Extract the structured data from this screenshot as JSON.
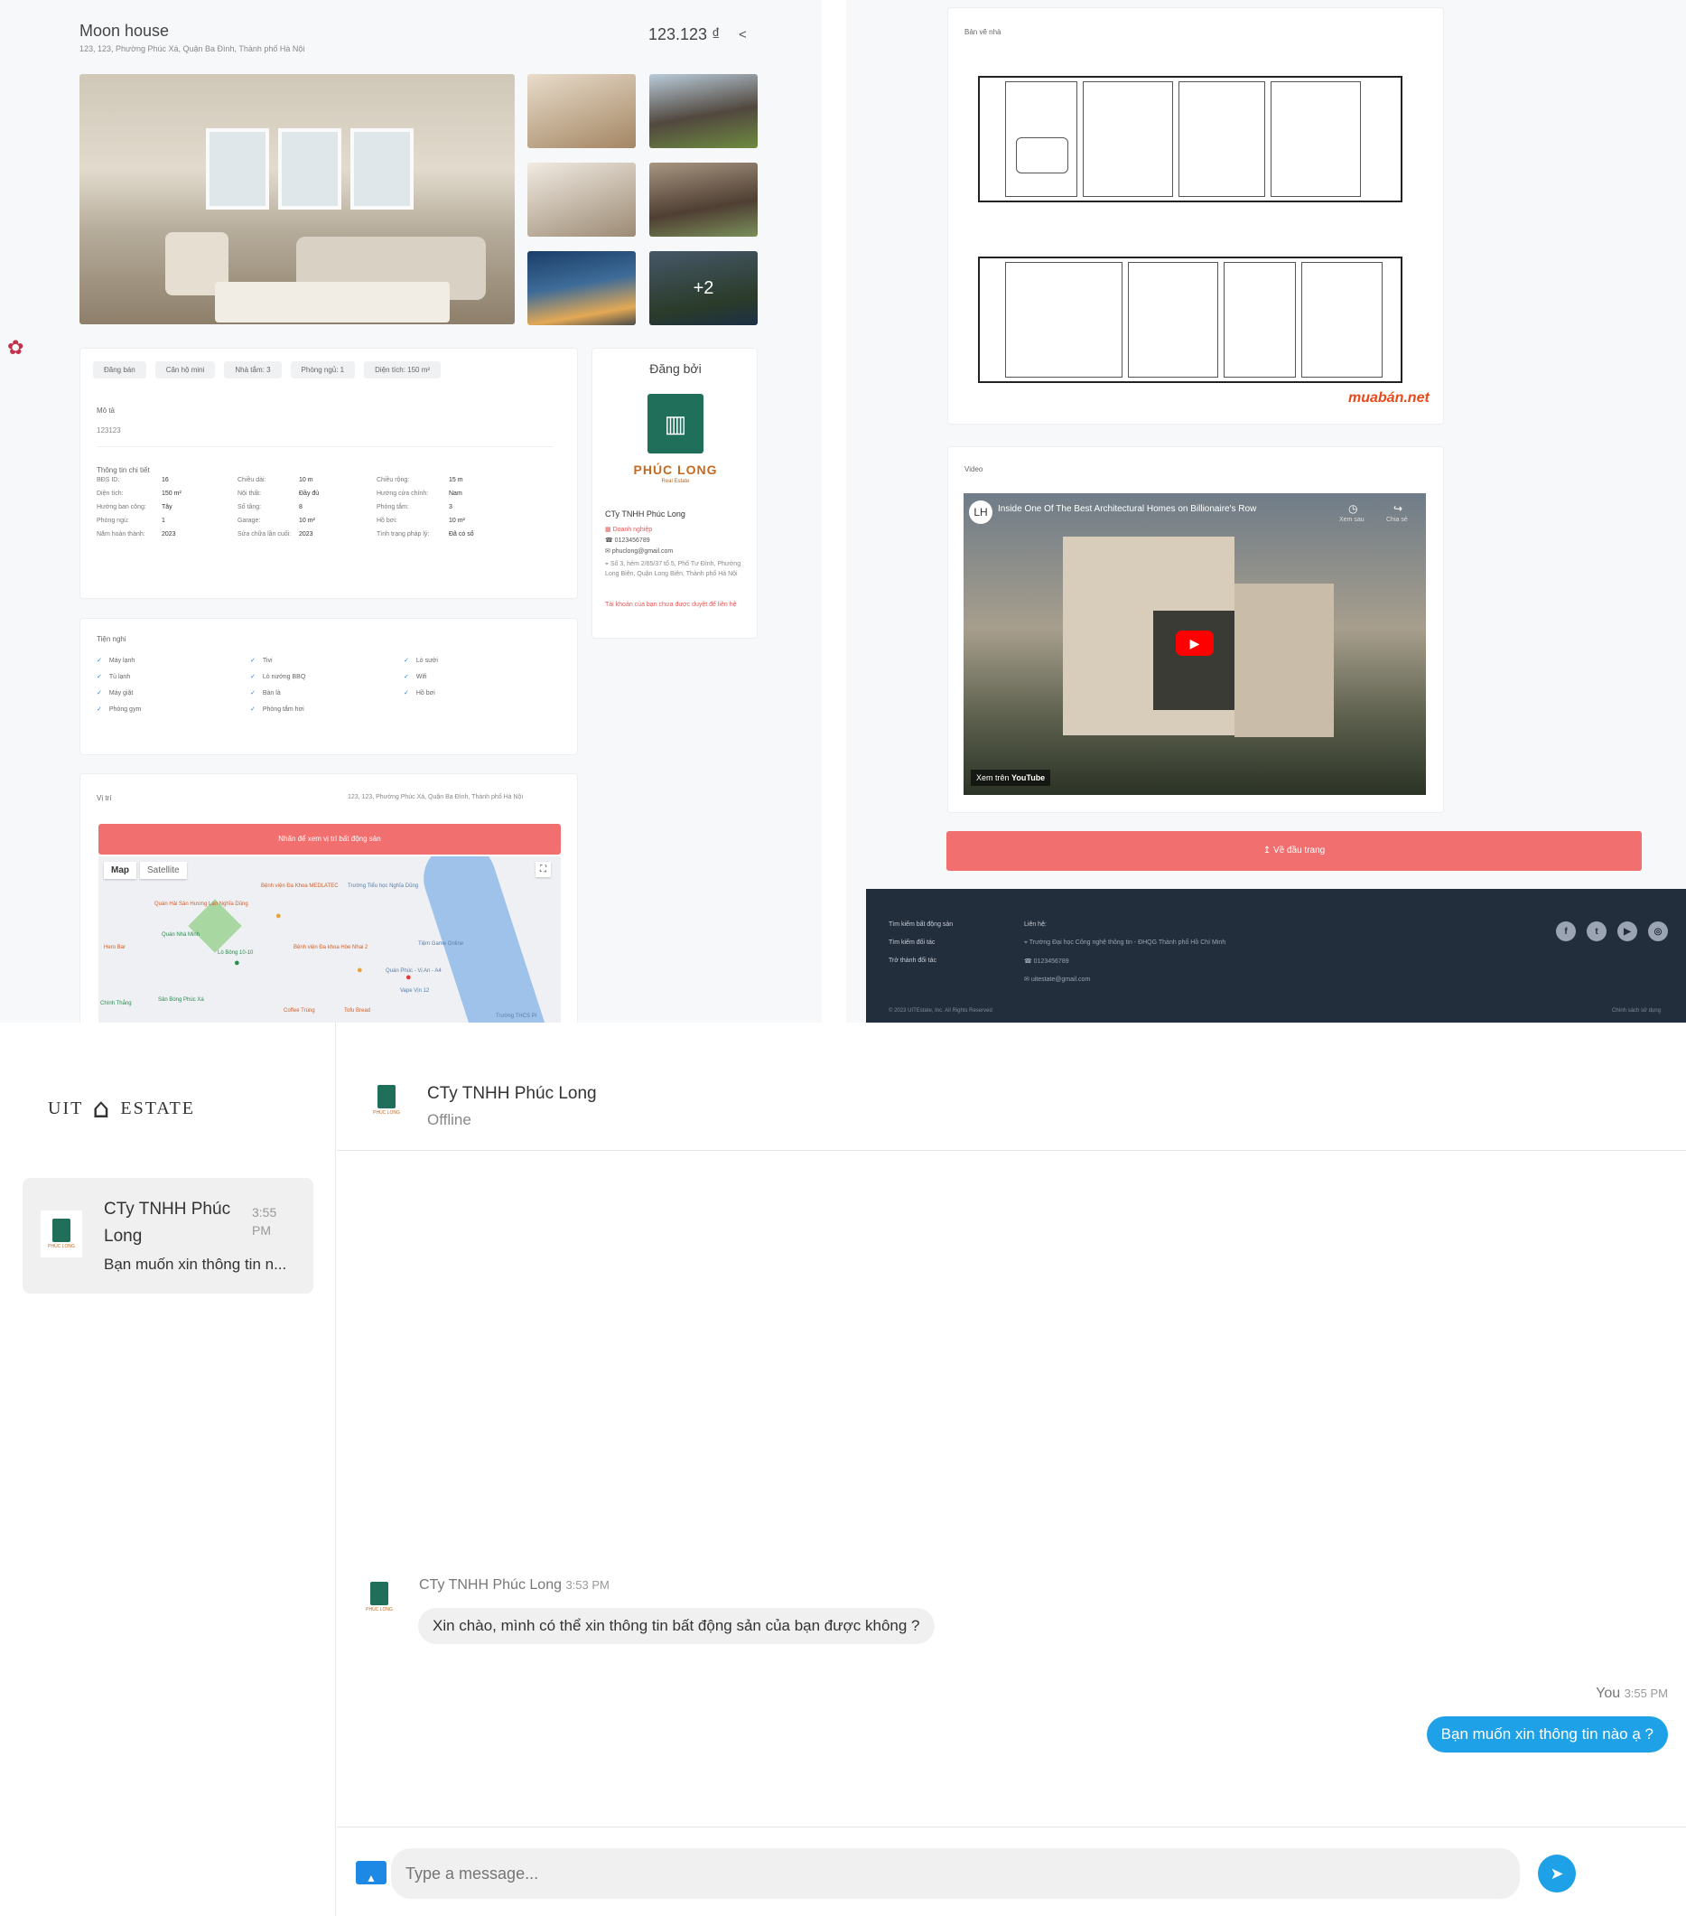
{
  "listing": {
    "title": "Moon house",
    "address": "123, 123, Phường Phúc Xá, Quận Ba Đình, Thành phố Hà Nội",
    "price": "123.123 ₫",
    "more_photos": "+2",
    "chips": [
      "Đăng bán",
      "Căn hộ mini",
      "Nhà tắm: 3",
      "Phòng ngủ: 1",
      "Diện tích: 150 m²"
    ],
    "description_label": "Mô tả",
    "description": "123123",
    "details_label": "Thông tin chi tiết",
    "details": [
      [
        "BĐS ID:",
        "16",
        "Chiều dài:",
        "10 m",
        "Chiều rộng:",
        "15 m"
      ],
      [
        "Diện tích:",
        "150 m²",
        "Nội thất:",
        "Đầy đủ",
        "Hướng cửa chính:",
        "Nam"
      ],
      [
        "Hướng ban công:",
        "Tây",
        "Số tầng:",
        "8",
        "Phòng tắm:",
        "3"
      ],
      [
        "Phòng ngủ:",
        "1",
        "Garage:",
        "10 m²",
        "Hồ bơi:",
        "10 m²"
      ],
      [
        "Năm hoàn thành:",
        "2023",
        "Sửa chữa lần cuối:",
        "2023",
        "Tình trạng pháp lý:",
        "Đã có sổ"
      ]
    ],
    "amenities_label": "Tiện nghi",
    "amenities": [
      "Máy lạnh",
      "Tivi",
      "Lò sưởi",
      "Tủ lạnh",
      "Lò nướng BBQ",
      "Wifi",
      "Máy giặt",
      "Bàn là",
      "Hồ bơi",
      "Phòng gym",
      "Phòng tắm hơi"
    ],
    "location_label": "Vị trí",
    "location_address": "123, 123, Phường Phúc Xá, Quận Ba Đình, Thành phố Hà Nội",
    "map_button": "Nhấn để xem vị trí bất động sản",
    "map_tabs": [
      "Map",
      "Satellite"
    ],
    "map_labels": [
      "Bệnh viện Đa Khoa MEDLATEC",
      "Trường Tiểu học Nghĩa Dũng",
      "Quán Hải Sản Hương Lan Nghĩa Dũng",
      "Quán Nhà Minh",
      "Hero Bar",
      "Lò Bông 10-10",
      "Bệnh viện Đa khoa Hòe Nhai 2",
      "Tiệm Game Online",
      "Quán Phúc - Vị An - A4",
      "Vape Vịn 12",
      "Coffee Trùng",
      "Tofu Bread",
      "Chính Thắng",
      "Sân Bóng Phúc Xá",
      "Trường THCS PI"
    ]
  },
  "agent": {
    "posted_by": "Đăng bởi",
    "logo_text": "PHÚC LONG",
    "logo_sub": "Real Estate",
    "name": "CTy TNHH Phúc Long",
    "type": "Doanh nghiệp",
    "phone": "0123456789",
    "email": "phuclong@gmail.com",
    "address": "Số 3, hẻm 2/65/37 tổ 5, Phố Tư Đình, Phường Long Biên, Quận Long Biên, Thành phố Hà Nội",
    "warning": "Tài khoản của bạn chưa được duyệt để liên hệ"
  },
  "plans": {
    "label": "Bản vẽ nhà",
    "watermark": "muabán.net"
  },
  "video": {
    "label": "Video",
    "title": "Inside One Of The Best Architectural Homes on Billionaire's Row",
    "watch_later": "Xem sau",
    "share": "Chia sẻ",
    "watch_on": "Xem trên",
    "youtube": "YouTube"
  },
  "back_to_top": "Về đầu trang",
  "footer": {
    "links": [
      "Tìm kiếm bất động sản",
      "Tìm kiếm đối tác",
      "Trở thành đối tác"
    ],
    "contact_label": "Liên hệ:",
    "contact_address": "Trường Đại học Công nghệ thông tin - ĐHQG Thành phố Hồ Chí Minh",
    "contact_phone": "0123456789",
    "contact_email": "uitestate@gmail.com",
    "copyright": "© 2023 UITEstate, Inc. All Rights Reserved",
    "terms": "Chính sách sử dụng",
    "social": [
      "f",
      "t",
      "▶",
      "◎"
    ]
  },
  "chat": {
    "brand_left": "UIT",
    "brand_right": "ESTATE",
    "conversation": {
      "name": "CTy TNHH Phúc Long",
      "time": "3:55 PM",
      "preview": "Bạn muốn xin thông tin n..."
    },
    "header": {
      "name": "CTy TNHH Phúc Long",
      "status": "Offline"
    },
    "messages": [
      {
        "sender": "CTy TNHH Phúc Long",
        "time": "3:53 PM",
        "text": "Xin chào, mình có thể xin thông tin bất động sản của bạn được không ?"
      },
      {
        "sender": "You",
        "time": "3:55 PM",
        "text": "Bạn muốn xin thông tin nào ạ ?"
      }
    ],
    "input_placeholder": "Type a message..."
  }
}
